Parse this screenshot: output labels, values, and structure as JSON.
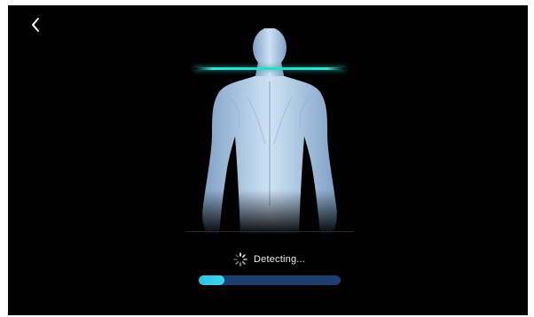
{
  "screen": {
    "status_text": "Detecting...",
    "progress": 0.18,
    "colors": {
      "background": "#000000",
      "scan_line": "#2fd6c8",
      "progress_track": "#1c3f70",
      "progress_fill": "#35d0ec"
    }
  },
  "icons": {
    "back": "chevron-left-icon",
    "spinner": "loading-spinner-icon",
    "figure": "human-body-back-icon"
  }
}
